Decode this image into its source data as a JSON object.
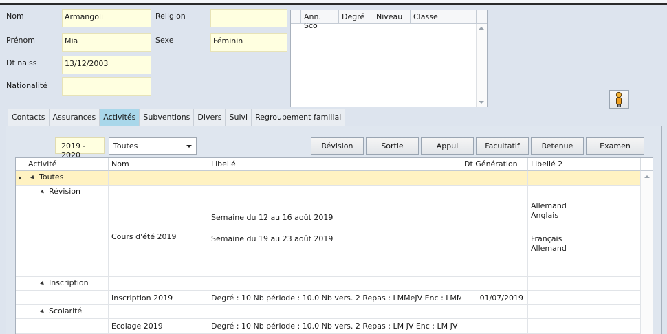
{
  "form": {
    "nom_label": "Nom",
    "nom_value": "Armangoli",
    "prenom_label": "Prénom",
    "prenom_value": "Mia",
    "dtnaiss_label": "Dt naiss",
    "dtnaiss_value": "13/12/2003",
    "nationalite_label": "Nationalité",
    "nationalite_value": "",
    "religion_label": "Religion",
    "religion_value": "",
    "sexe_label": "Sexe",
    "sexe_value": "Féminin"
  },
  "scolarite": {
    "columns": [
      "Ann. Sco",
      "Degré",
      "Niveau",
      "Classe"
    ]
  },
  "tabs": [
    "Contacts",
    "Assurances",
    "Activités",
    "Subventions",
    "Divers",
    "Suivi",
    "Regroupement familial"
  ],
  "activities": {
    "year": "2019 - 2020",
    "filter": "Toutes",
    "buttons": [
      "Révision",
      "Sortie",
      "Appui",
      "Facultatif",
      "Retenue",
      "Examen"
    ],
    "columns": [
      "Activité",
      "Nom",
      "Libellé",
      "Dt Génération",
      "Libellé 2"
    ],
    "root": "Toutes",
    "groups": {
      "revision": "Révision",
      "inscription": "Inscription",
      "scolarite": "Scolarité"
    },
    "rows": {
      "cours_nom": "Cours d'été 2019",
      "cours_lib1": "Semaine du 12 au 16 août 2019",
      "cours_lib2": "Semaine du 19 au 23 août 2019",
      "cours_l2a": "Allemand",
      "cours_l2b": "Anglais",
      "cours_l2c": "Français",
      "cours_l2d": "Allemand",
      "insc_nom": "Inscription 2019",
      "insc_lib": "Degré : 10 Nb période : 10.0 Nb vers. 2  Repas : LMMeJV  Enc : LMM...",
      "insc_date": "01/07/2019",
      "ecol_nom": "Ecolage 2019",
      "ecol_lib": "Degré : 10 Nb période : 10.0 Nb vers. 2  Repas : LM JV  Enc : LM JV"
    }
  }
}
